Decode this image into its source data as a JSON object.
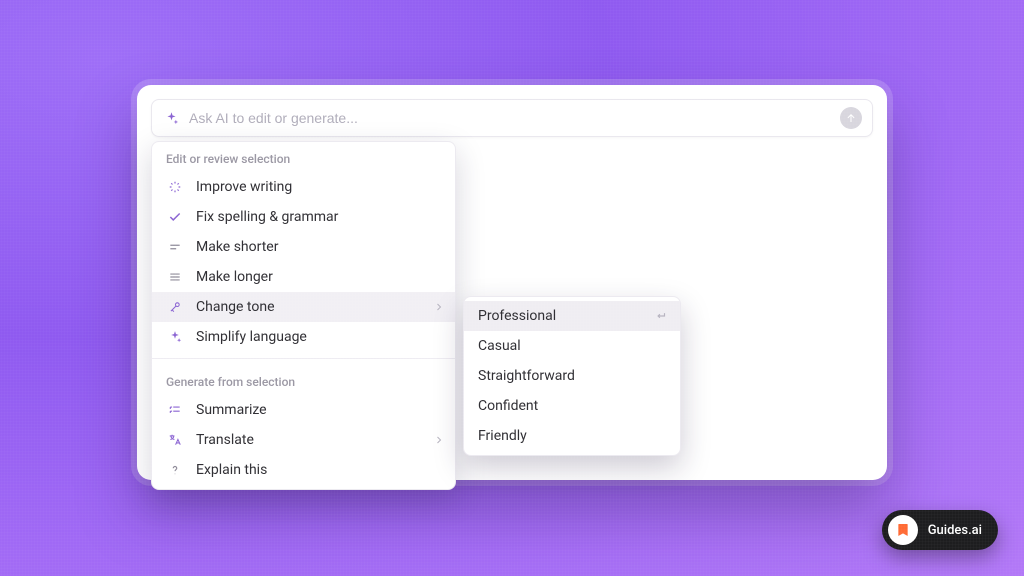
{
  "search": {
    "placeholder": "Ask AI to edit or generate..."
  },
  "menu": {
    "section1_label": "Edit or review selection",
    "section2_label": "Generate from selection",
    "improve": "Improve writing",
    "fix": "Fix spelling & grammar",
    "shorter": "Make shorter",
    "longer": "Make longer",
    "tone": "Change tone",
    "simplify": "Simplify language",
    "summarize": "Summarize",
    "translate": "Translate",
    "explain": "Explain this"
  },
  "submenu": {
    "professional": "Professional",
    "casual": "Casual",
    "straightforward": "Straightforward",
    "confident": "Confident",
    "friendly": "Friendly"
  },
  "badge": {
    "label": "Guides.ai"
  }
}
